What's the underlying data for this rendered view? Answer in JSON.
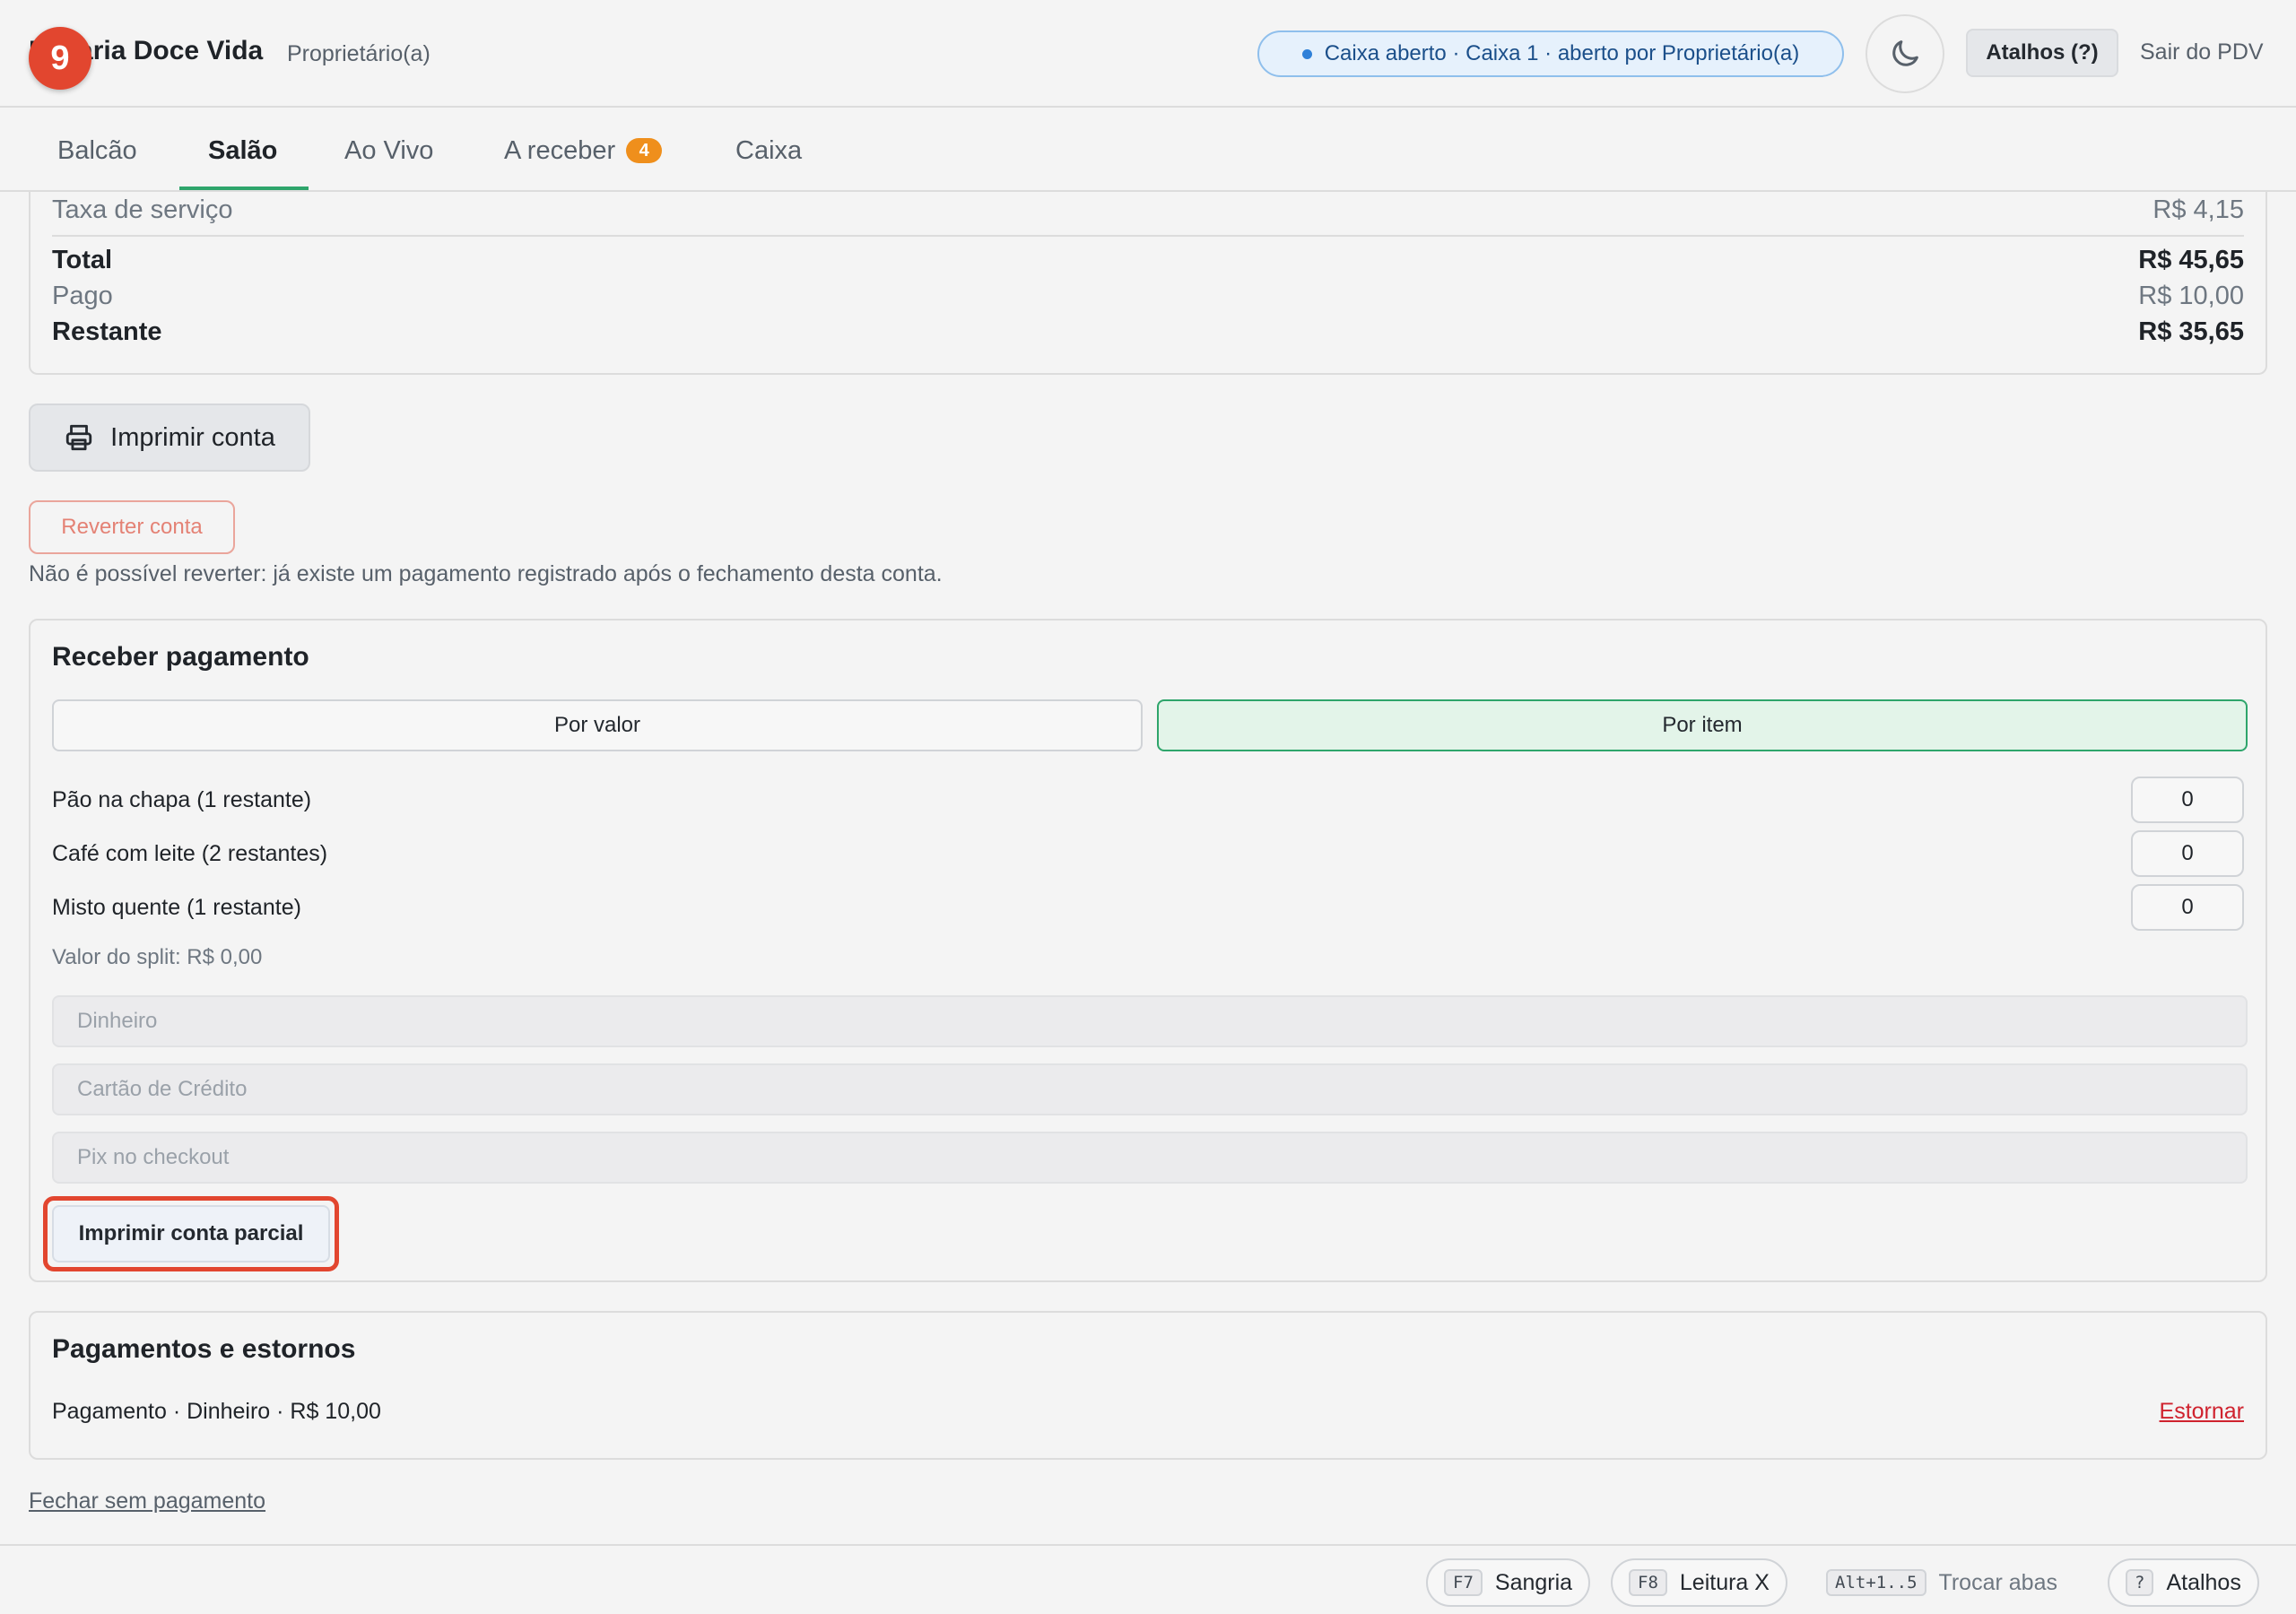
{
  "header": {
    "brand": "Padaria Doce Vida",
    "role": "Proprietário(a)",
    "step_badge": "9",
    "status": "Caixa aberto · Caixa 1 · aberto por Proprietário(a)",
    "theme_icon": "moon-icon",
    "shortcuts_label": "Atalhos (?)",
    "logout_label": "Sair do PDV"
  },
  "tabs": [
    {
      "label": "Balcão"
    },
    {
      "label": "Salão"
    },
    {
      "label": "Ao Vivo"
    },
    {
      "label": "A receber",
      "count": "4"
    },
    {
      "label": "Caixa"
    }
  ],
  "active_tab": "Salão",
  "totals": {
    "service_label": "Taxa de serviço",
    "service_value": "R$ 4,15",
    "total_label": "Total",
    "total_value": "R$ 45,65",
    "paid_label": "Pago",
    "paid_value": "R$ 10,00",
    "remaining_label": "Restante",
    "remaining_value": "R$ 35,65"
  },
  "actions": {
    "print_label": "Imprimir conta",
    "print_icon": "printer-icon",
    "revert_label": "Reverter conta",
    "revert_note": "Não é possível reverter: já existe um pagamento registrado após o fechamento desta conta."
  },
  "payment": {
    "title": "Receber pagamento",
    "mode_value_label": "Por valor",
    "mode_item_label": "Por item",
    "selected_mode": "Por item",
    "items": [
      {
        "label": "Pão na chapa (1 restante)",
        "qty": "0"
      },
      {
        "label": "Café com leite (2 restantes)",
        "qty": "0"
      },
      {
        "label": "Misto quente (1 restante)",
        "qty": "0"
      }
    ],
    "split_note": "Valor do split: R$ 0,00",
    "methods": [
      "Dinheiro",
      "Cartão de Crédito",
      "Pix no checkout"
    ],
    "partial_print_label": "Imprimir conta parcial"
  },
  "history": {
    "title": "Pagamentos e estornos",
    "entry": "Pagamento · Dinheiro · R$ 10,00",
    "reverse_label": "Estornar"
  },
  "close_without_payment": "Fechar sem pagamento",
  "footer": {
    "sangria_key": "F7",
    "sangria_label": "Sangria",
    "leitura_key": "F8",
    "leitura_label": "Leitura X",
    "tabs_key": "Alt+1..5",
    "tabs_label": "Trocar abas",
    "help_key": "?",
    "help_label": "Atalhos"
  },
  "colors": {
    "accent_green": "#2ea56b",
    "highlight_red": "#e2462f",
    "badge_orange": "#ef8f1c",
    "status_blue": "#2f80d8"
  }
}
